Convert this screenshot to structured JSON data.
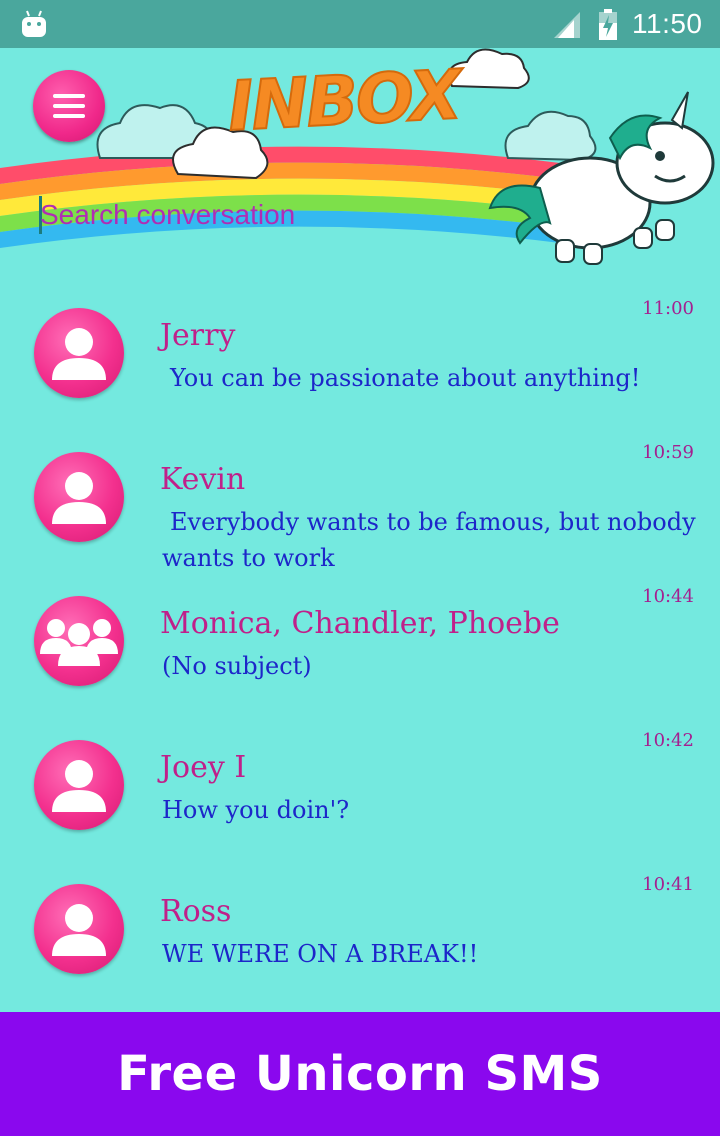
{
  "status_bar": {
    "time": "11:50",
    "icons": [
      "android-icon",
      "signal-icon",
      "battery-icon"
    ]
  },
  "header": {
    "title": "INBOX",
    "menu_icon": "hamburger-icon"
  },
  "search": {
    "placeholder": "Search conversation"
  },
  "conversations": [
    {
      "name": "Jerry",
      "snippet": "You can be passionate about anything!",
      "time": "11:00",
      "avatar": "person-icon"
    },
    {
      "name": "Kevin",
      "snippet": "Everybody wants to be famous, but nobody wants to work",
      "time": "10:59",
      "avatar": "person-icon"
    },
    {
      "name": "Monica, Chandler, Phoebe",
      "snippet": "(No subject)",
      "time": "10:44",
      "avatar": "group-icon"
    },
    {
      "name": "Joey I",
      "snippet": "How you doin'?",
      "time": "10:42",
      "avatar": "person-icon"
    },
    {
      "name": "Ross",
      "snippet": "WE WERE ON A BREAK!!",
      "time": "10:41",
      "avatar": "person-icon"
    }
  ],
  "footer": {
    "title": "Free Unicorn SMS"
  },
  "colors": {
    "background": "#74e9df",
    "status_bar": "#4aa79d",
    "accent_pink": "#f0288a",
    "name_color": "#c0208a",
    "snippet_color": "#1d26c9",
    "footer": "#8a08ee"
  }
}
